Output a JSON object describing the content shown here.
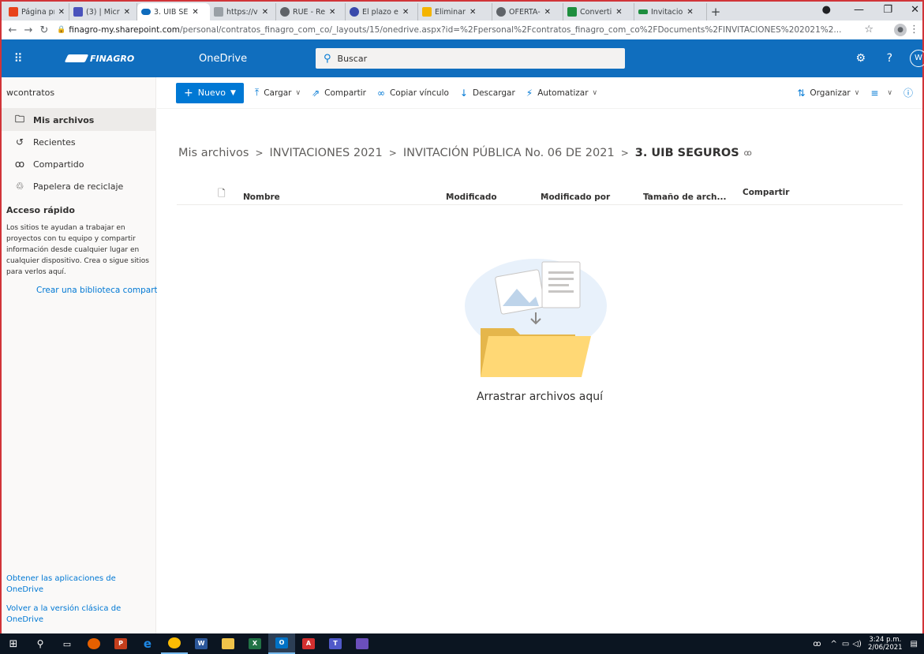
{
  "browser": {
    "tabs": [
      {
        "title": "Página pr",
        "favicon_color": "#e8431b",
        "active": false
      },
      {
        "title": "(3) | Micr",
        "favicon_color": "#4b53bc",
        "active": false
      },
      {
        "title": "3. UIB SE",
        "favicon_color": "#0f6cbd",
        "active": true
      },
      {
        "title": "https://v",
        "favicon_color": "#9aa0a6",
        "active": false
      },
      {
        "title": "RUE - Re",
        "favicon_color": "#5f6368",
        "active": false
      },
      {
        "title": "El plazo e",
        "favicon_color": "#3949ab",
        "active": false
      },
      {
        "title": "Eliminar",
        "favicon_color": "#f4b400",
        "active": false
      },
      {
        "title": "OFERTA-",
        "favicon_color": "#5f6368",
        "active": false
      },
      {
        "title": "Converti",
        "favicon_color": "#1e8e3e",
        "active": false
      },
      {
        "title": "Invitacio",
        "favicon_color": "#1e8e3e",
        "active": false
      }
    ],
    "url_domain": "finagro-my.sharepoint.com",
    "url_path": "/personal/contratos_finagro_com_co/_layouts/15/onedrive.aspx?id=%2Fpersonal%2Fcontratos_finagro_com_co%2FDocuments%2FINVITACIONES%202021%2..."
  },
  "suite": {
    "brand": "FINAGRO",
    "app_name": "OneDrive",
    "search_placeholder": "Buscar",
    "user_initial": "W",
    "accent": "#106ebe"
  },
  "sidebar": {
    "owner": "wcontratos",
    "items": [
      {
        "label": "Mis archivos",
        "icon": "folder-icon",
        "selected": true
      },
      {
        "label": "Recientes",
        "icon": "clock-icon",
        "selected": false
      },
      {
        "label": "Compartido",
        "icon": "people-icon",
        "selected": false
      },
      {
        "label": "Papelera de reciclaje",
        "icon": "trash-icon",
        "selected": false
      }
    ],
    "quick_access_title": "Acceso rápido",
    "quick_access_desc": "Los sitios te ayudan a trabajar en proyectos con tu equipo y compartir información desde cualquier lugar en cualquier dispositivo. Crea o sigue sitios para verlos aquí.",
    "create_library": "Crear una biblioteca comparti",
    "get_apps": "Obtener las aplicaciones de OneDrive",
    "classic": "Volver a la versión clásica de OneDrive"
  },
  "commands": {
    "new": "Nuevo",
    "upload": "Cargar",
    "share": "Compartir",
    "copy_link": "Copiar vínculo",
    "download": "Descargar",
    "automate": "Automatizar",
    "sort": "Organizar"
  },
  "breadcrumb": {
    "items": [
      "Mis archivos",
      "INVITACIONES 2021",
      "INVITACIÓN PÚBLICA No. 06 DE 2021"
    ],
    "current": "3. UIB SEGUROS"
  },
  "columns": {
    "name": "Nombre",
    "modified": "Modificado",
    "modified_by": "Modificado por",
    "size": "Tamaño de arch...",
    "sharing": "Compartir"
  },
  "empty_state": "Arrastrar archivos aquí",
  "taskbar": {
    "clock_time": "3:24 p.m.",
    "clock_date": "2/06/2021"
  }
}
